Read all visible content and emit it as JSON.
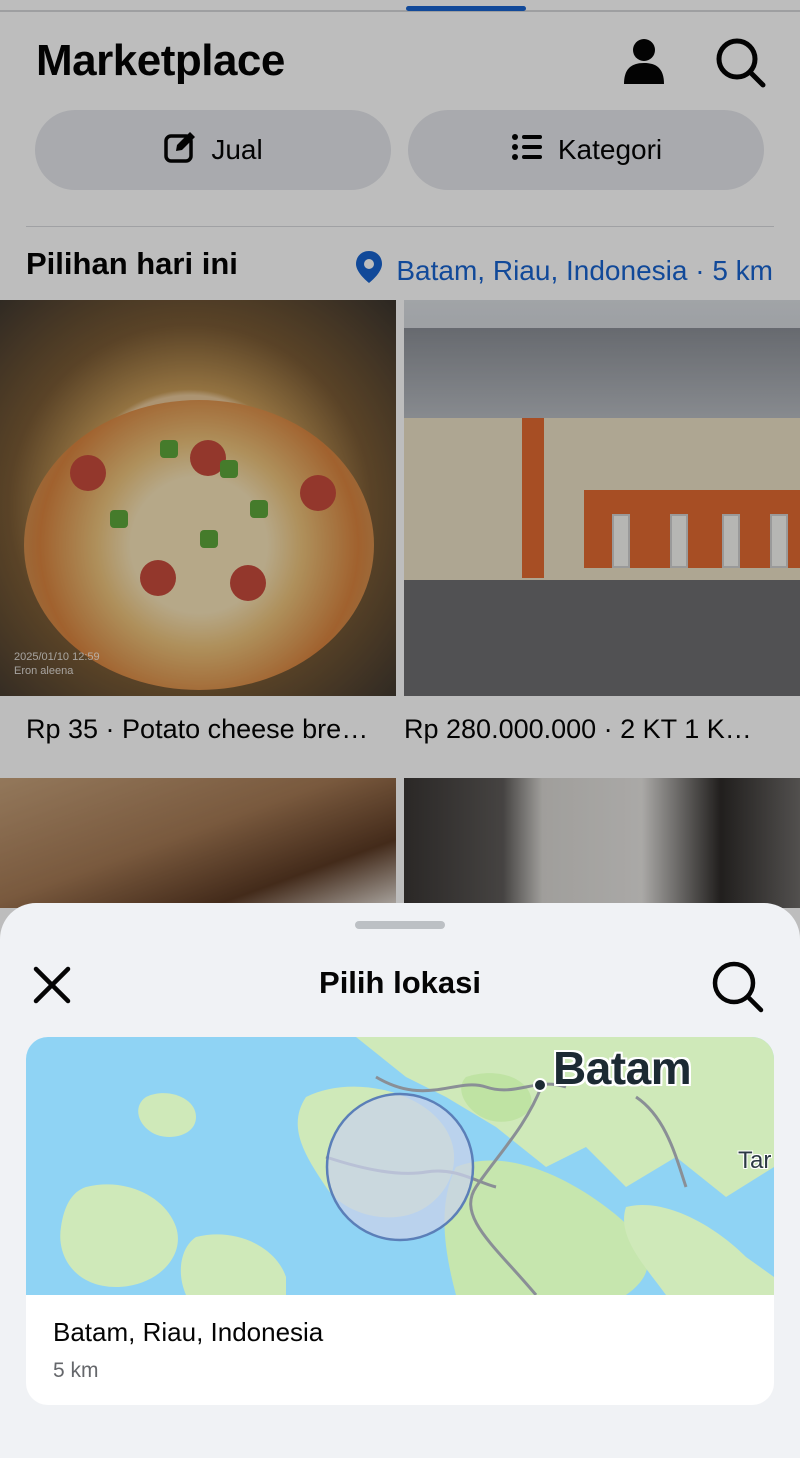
{
  "header": {
    "title": "Marketplace",
    "profile_icon": "person-icon",
    "search_icon": "search-icon"
  },
  "actions": {
    "sell_label": "Jual",
    "sell_icon": "edit-icon",
    "categories_label": "Kategori",
    "categories_icon": "list-icon"
  },
  "section": {
    "title": "Pilihan hari ini",
    "location": "Batam, Riau, Indonesia · 5 km",
    "location_icon": "pin-icon"
  },
  "listings": [
    {
      "caption": "Rp 35 · Potato cheese bre…",
      "image_stamp_1": "2025/01/10 12:59",
      "image_stamp_2": "Eron aleena"
    },
    {
      "caption": "Rp 280.000.000 · 2 KT 1 K…"
    }
  ],
  "sheet": {
    "title": "Pilih lokasi",
    "close_icon": "close-icon",
    "search_icon": "search-icon",
    "map": {
      "city_label": "Batam",
      "edge_label": "Tar",
      "info_icon": "info-icon"
    },
    "location_name": "Batam, Riau, Indonesia",
    "radius": "5 km"
  },
  "colors": {
    "accent": "#1763cf",
    "sheet_bg": "#f0f2f5",
    "pill_bg": "#e4e6eb",
    "map_water": "#8fd3f4",
    "map_land": "#cfe9b9"
  }
}
